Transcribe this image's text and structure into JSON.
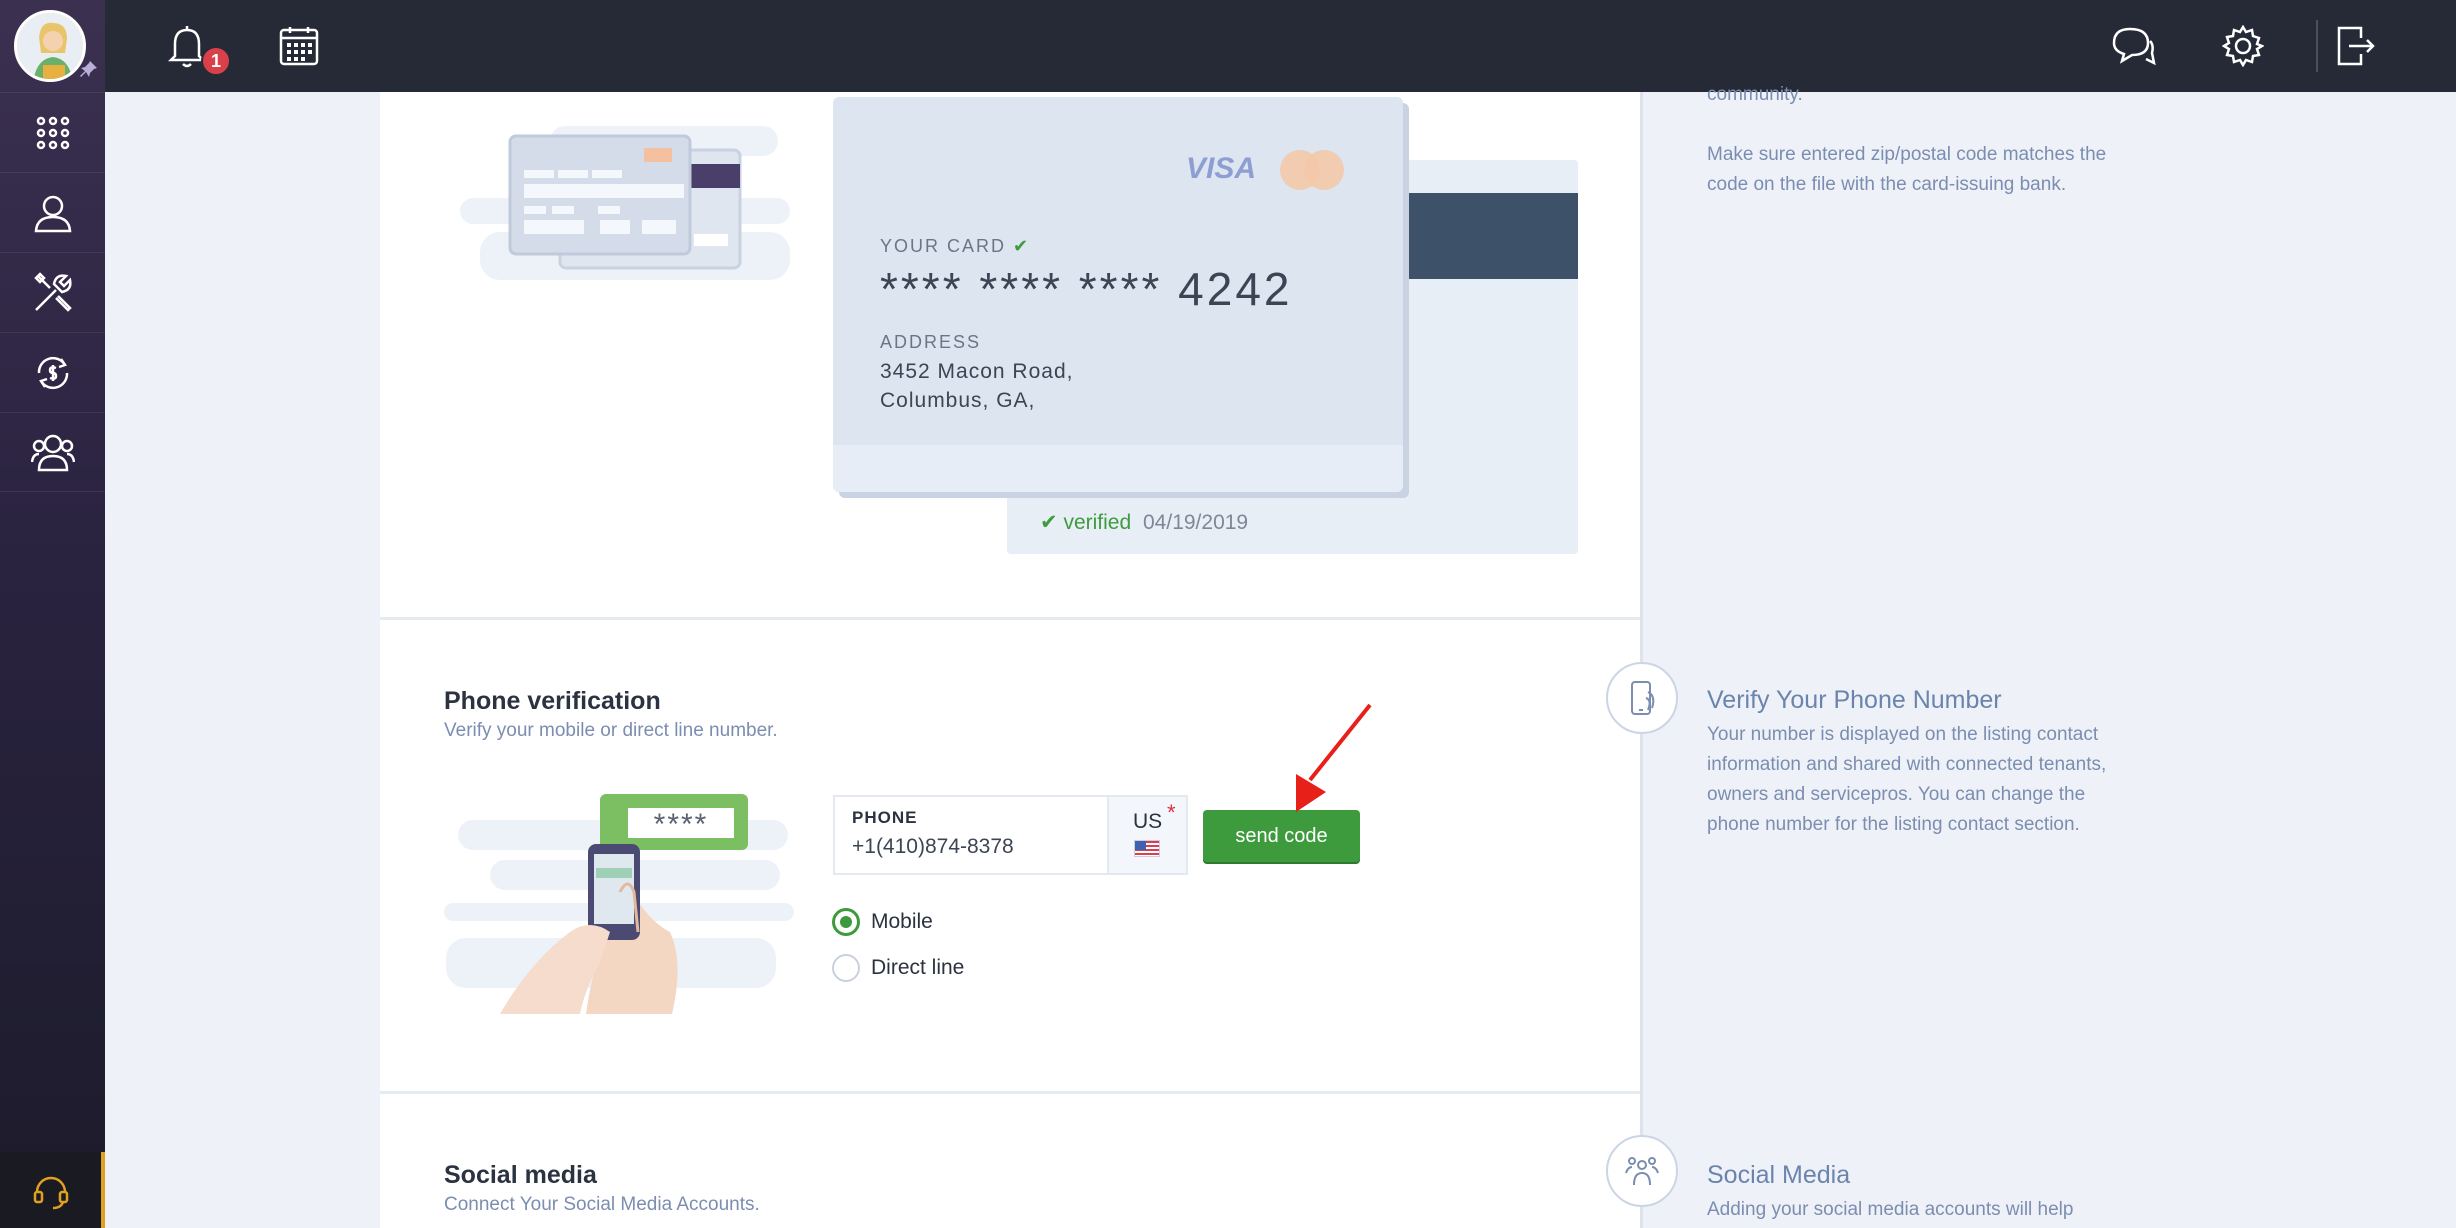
{
  "topbar": {
    "notification_count": "1"
  },
  "card": {
    "brand": "VISA",
    "mc_brand": "MasterCard",
    "your_card_label": "YOUR CARD",
    "masked_number": "**** **** ****",
    "last4": "4242",
    "address_label": "ADDRESS",
    "address_line1": "3452 Macon Road,",
    "address_line2": "Columbus, GA,",
    "verified_label": "verified",
    "verified_date": "04/19/2019"
  },
  "phone_section": {
    "title": "Phone verification",
    "subtitle": "Verify your mobile or direct line number.",
    "bubble_text": "****",
    "phone_label": "PHONE",
    "phone_value": "+1(410)874-8378",
    "country": "US",
    "required_mark": "*",
    "send_button": "send code",
    "radio_mobile": "Mobile",
    "radio_direct": "Direct line",
    "selected_type": "Mobile"
  },
  "social_section": {
    "title": "Social media",
    "subtitle": "Connect Your Social Media Accounts."
  },
  "info": {
    "top_partial": "community.",
    "zip_note": "Make sure entered zip/postal code matches the code on the file with the card-issuing bank.",
    "phone_title": "Verify Your Phone Number",
    "phone_text": "Your number is displayed on the listing contact information and shared with connected tenants, owners and servicepros. You can change the phone number for the listing contact section.",
    "social_title": "Social Media",
    "social_text": "Adding your social media accounts will help"
  },
  "colors": {
    "accent_green": "#3d9a3d",
    "topbar": "#262a36",
    "badge_red": "#d9404a"
  }
}
